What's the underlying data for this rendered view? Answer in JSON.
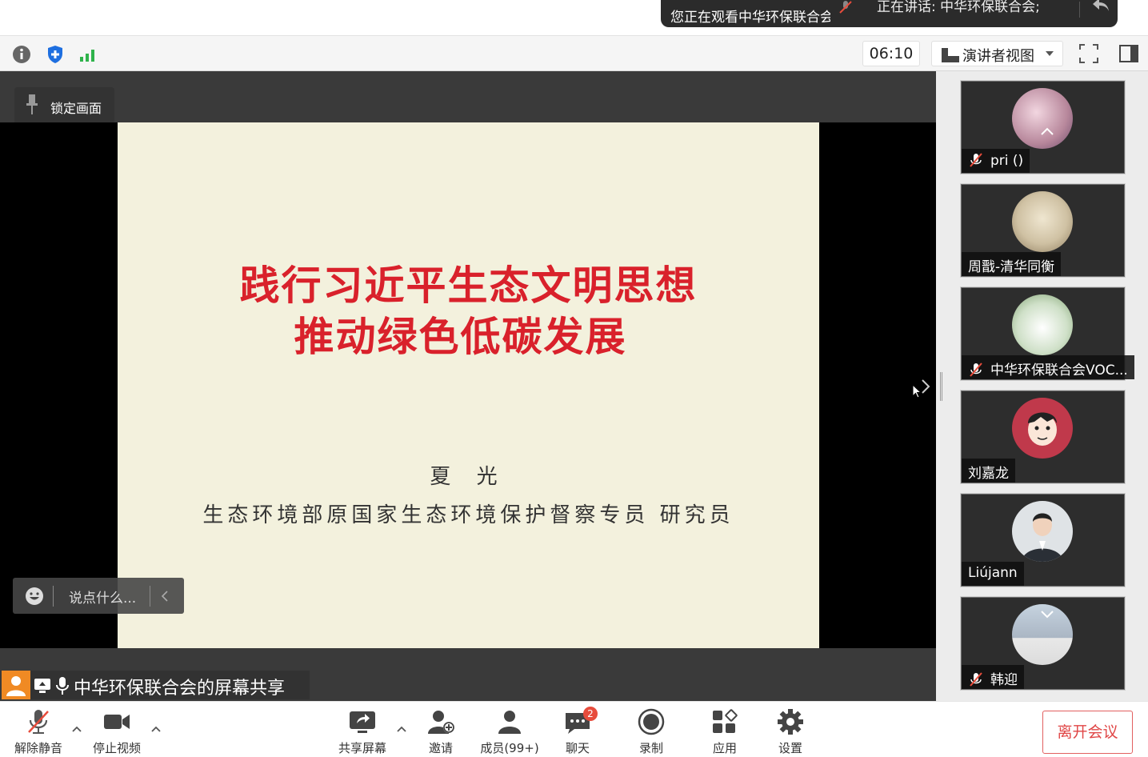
{
  "notification": {
    "watching": "您正在观看中华环保联合会",
    "speaking": "正在讲话: 中华环保联合会;"
  },
  "toolbar": {
    "timer": "06:10",
    "view_mode": "演讲者视图"
  },
  "stage": {
    "lock_label": "锁定画面",
    "chat_placeholder": "说点什么...",
    "share_label": "中华环保联合会的屏幕共享"
  },
  "slide": {
    "title_line1": "践行习近平生态文明思想",
    "title_line2": "推动绿色低碳发展",
    "author": "夏 光",
    "role": "生态环境部原国家生态环境保护督察专员  研究员"
  },
  "participants": [
    {
      "name": "pri  ()",
      "muted": true,
      "avatar_color": "#b8889c"
    },
    {
      "name": "周戬-清华同衡",
      "muted": false,
      "avatar_color": "#cfc1a3"
    },
    {
      "name": "中华环保联合会VOC...",
      "muted": true,
      "avatar_color": "#cfe0c8"
    },
    {
      "name": "刘嘉龙",
      "muted": false,
      "avatar_color": "#c0394b"
    },
    {
      "name": "Liújann",
      "muted": false,
      "avatar_color": "#9aa4ad"
    },
    {
      "name": "韩迎",
      "muted": true,
      "avatar_color": "#aab6c4"
    }
  ],
  "controls": {
    "unmute": "解除静音",
    "stop_video": "停止视频",
    "share_screen": "共享屏幕",
    "invite": "邀请",
    "members": "成员(99+)",
    "chat": "聊天",
    "chat_badge": "2",
    "record": "录制",
    "apps": "应用",
    "settings": "设置",
    "leave": "离开会议"
  },
  "colors": {
    "slide_title": "#d9212b",
    "slide_bg": "#f3f1dd",
    "leave_red": "#e04646",
    "share_avatar": "#f08a24"
  }
}
